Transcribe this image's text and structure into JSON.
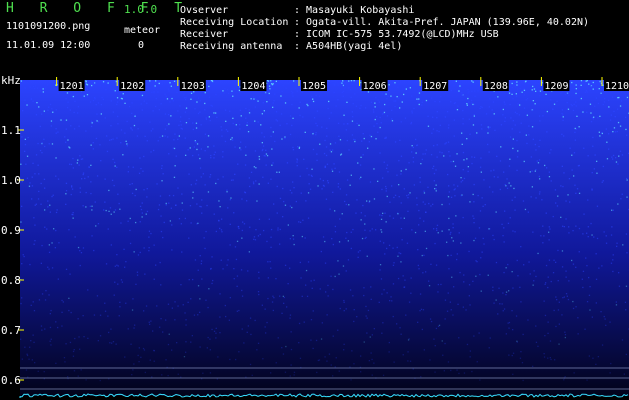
{
  "header": {
    "app_title": "H R O F F T",
    "app_version": "1.0.0",
    "file_name": "1101091200.png",
    "date_time": "11.01.09 12:00",
    "meteor_label": "meteor",
    "meteor_count": "0"
  },
  "info": [
    {
      "label": "Ovserver",
      "value": ": Masayuki Kobayashi"
    },
    {
      "label": "Receiving Location",
      "value": ": Ogata-vill. Akita-Pref. JAPAN (139.96E, 40.02N)"
    },
    {
      "label": "Receiver",
      "value": ": ICOM IC-575 53.7492(@LCD)MHz USB"
    },
    {
      "label": "Receiving antenna",
      "value": ": A504HB(yagi 4el)"
    }
  ],
  "spectrogram": {
    "freq_unit": "kHz",
    "freq_ticks": [
      "1.1",
      "1.0",
      "0.9",
      "0.8",
      "0.7",
      "0.6"
    ],
    "time_ticks": [
      "1201",
      "1202",
      "1203",
      "1204",
      "1205",
      "1206",
      "1207",
      "1208",
      "1209",
      "1210"
    ],
    "colors": {
      "background": "#000000",
      "tick_text": "#ffffff",
      "tick_mark": "#ffff00",
      "noise_low": "#10189a",
      "noise_high": "#2c44ff",
      "speckle": "#5fd7ff",
      "trace": "#38e0ff"
    }
  }
}
